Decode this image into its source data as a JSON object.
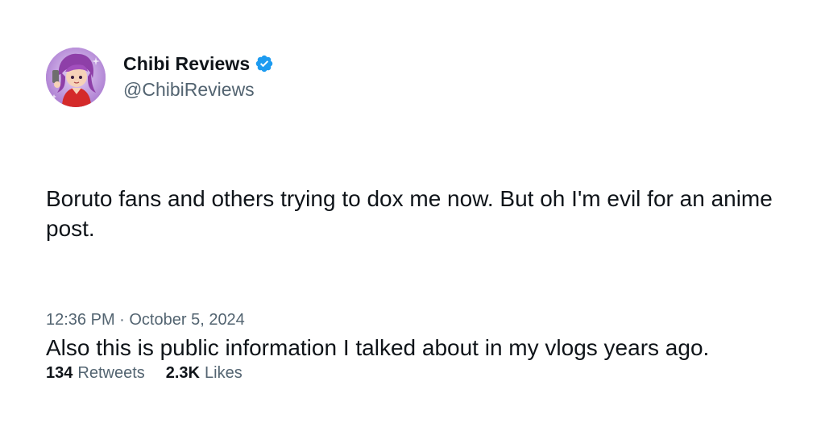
{
  "author": {
    "display_name": "Chibi Reviews",
    "handle": "@ChibiReviews",
    "verified": true,
    "verified_icon": "verified-badge-icon",
    "verified_color": "#1d9bf0"
  },
  "tweet": {
    "paragraphs": [
      "Boruto fans and others trying to dox me now. But oh I'm evil for an anime post.",
      "Also this is public information I talked about in my vlogs years ago."
    ],
    "timestamp": "12:36 PM · October 5, 2024"
  },
  "stats": {
    "retweets_count": "134",
    "retweets_label": "Retweets",
    "likes_count": "2.3K",
    "likes_label": "Likes"
  },
  "colors": {
    "text_primary": "#0f1419",
    "text_secondary": "#536471",
    "accent": "#1d9bf0"
  }
}
